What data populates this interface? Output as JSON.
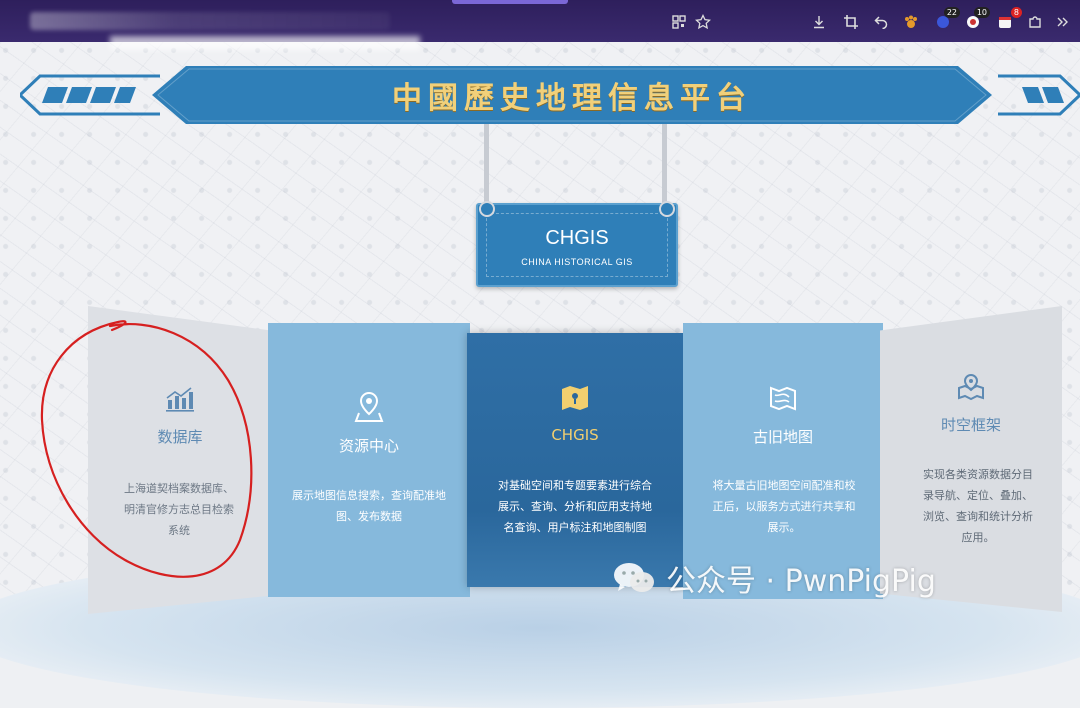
{
  "browser": {
    "badges": {
      "ext1": "22",
      "ext2": "10",
      "ext3": "8"
    },
    "icons": [
      "qr-code-icon",
      "star-icon",
      "download-icon",
      "crop-icon",
      "undo-icon",
      "paw-icon",
      "ext-badge-icon",
      "ext-badge-icon",
      "ext-badge-icon",
      "extensions-icon",
      "overflow-icon"
    ]
  },
  "header": {
    "banner_title": "中國歷史地理信息平台",
    "sign_title": "CHGIS",
    "sign_subtitle": "CHINA HISTORICAL GIS"
  },
  "cards": [
    {
      "title": "数据库",
      "desc": "上海道契档案数据库、明清官修方志总目检索系统",
      "icon": "bar-chart-icon"
    },
    {
      "title": "资源中心",
      "desc": "展示地图信息搜索，查询配准地图、发布数据",
      "icon": "map-pin-icon"
    },
    {
      "title": "CHGIS",
      "desc": "对基础空间和专题要素进行综合展示、查询、分析和应用支持地名查询、用户标注和地图制图",
      "icon": "map-fold-icon"
    },
    {
      "title": "古旧地图",
      "desc": "将大量古旧地图空间配准和校正后，以服务方式进行共享和展示。",
      "icon": "scroll-map-icon"
    },
    {
      "title": "时空框架",
      "desc": "实现各类资源数据分目录导航、定位、叠加、浏览、查询和统计分析应用。",
      "icon": "layer-map-icon"
    }
  ],
  "watermark": {
    "text": "公众号 · PwnPigPig"
  },
  "colors": {
    "banner": "#2f7fb8",
    "gold": "#f1d07a",
    "card_light": "#86b9dc",
    "card_dark": "#2a679c",
    "annotation": "#d62020"
  }
}
